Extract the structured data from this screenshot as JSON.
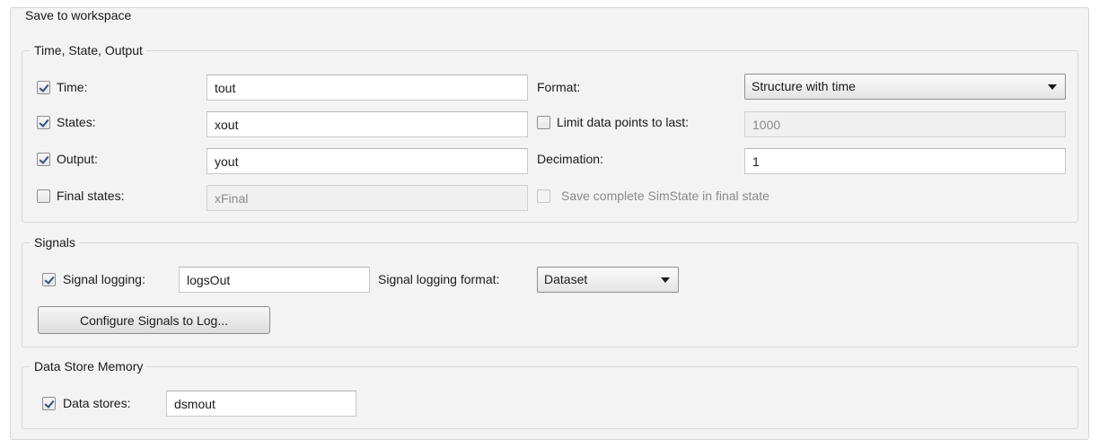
{
  "workspace": {
    "title": "Save to workspace",
    "tso": {
      "title": "Time, State, Output",
      "time": {
        "label": "Time:",
        "checked": true,
        "value": "tout"
      },
      "states": {
        "label": "States:",
        "checked": true,
        "value": "xout"
      },
      "output": {
        "label": "Output:",
        "checked": true,
        "value": "yout"
      },
      "final_states": {
        "label": "Final states:",
        "checked": false,
        "value": "xFinal",
        "enabled": false
      },
      "format": {
        "label": "Format:",
        "selected": "Structure with time"
      },
      "limit": {
        "label": "Limit data points to last:",
        "checked": false,
        "value": "1000",
        "enabled": false
      },
      "decimation": {
        "label": "Decimation:",
        "value": "1"
      },
      "simstate": {
        "label": "Save complete SimState in final state",
        "checked": false,
        "enabled": false
      }
    },
    "signals": {
      "title": "Signals",
      "logging": {
        "label": "Signal logging:",
        "checked": true,
        "value": "logsOut"
      },
      "format": {
        "label": "Signal logging format:",
        "selected": "Dataset"
      },
      "configure_button": "Configure Signals to Log..."
    },
    "dsm": {
      "title": "Data Store Memory",
      "stores": {
        "label": "Data stores:",
        "checked": true,
        "value": "dsmout"
      }
    }
  }
}
